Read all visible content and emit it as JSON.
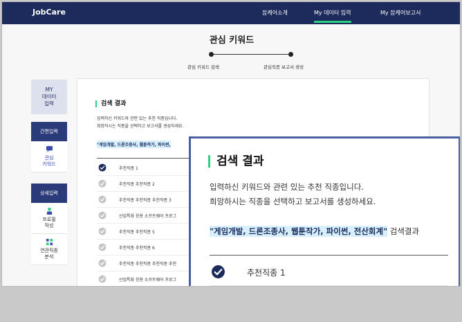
{
  "header": {
    "logo": "JobCare",
    "nav": [
      {
        "label": "잡케어소개",
        "active": false
      },
      {
        "label": "My 데이터 입력",
        "active": true
      },
      {
        "label": "My 잡케어보고서",
        "active": false
      }
    ]
  },
  "page": {
    "title": "관심 키워드",
    "steps": [
      {
        "label": "관심 키워드 검색"
      },
      {
        "label": "관심직종 보고서 생성"
      }
    ]
  },
  "sidebar": {
    "header": "MY\n데이터\n입력",
    "sections": [
      {
        "title": "간편입력",
        "items": [
          {
            "label": "관심\n키워드",
            "icon": "chat-icon",
            "active": true
          }
        ]
      },
      {
        "title": "상세입력",
        "items": [
          {
            "label": "프로필\n작성",
            "icon": "person-icon",
            "active": false
          },
          {
            "label": "연관직종\n분석",
            "icon": "grid-icon",
            "active": false
          }
        ]
      }
    ]
  },
  "results": {
    "title": "검색 결과",
    "desc_line1": "입력하신 키워드와 관련 있는 추천 직종입니다.",
    "desc_line2": "희망하시는 직종을 선택하고 보고서를 생성하세요.",
    "keywords_truncated": "\"게임개발, 드론조종사, 웹툰작가, 파이썬,",
    "keywords": "\"게임개발, 드론조종사, 웹툰작가, 파이썬, 전산회계\"",
    "keywords_suffix": " 검색결과",
    "items": [
      {
        "label": "추천직종 1",
        "checked": true
      },
      {
        "label": "추천직종 추천직종 2",
        "checked": false
      },
      {
        "label": "추천직종 추천직종 추천직종 3",
        "checked": false
      },
      {
        "label": "산업특화 응용 소프트웨어 프로그",
        "checked": false
      },
      {
        "label": "추천직종 추천직종 5",
        "checked": false
      },
      {
        "label": "추천직종 추천직종 6",
        "checked": false
      },
      {
        "label": "추천직종 추천직종 추천직종 추천",
        "checked": false
      },
      {
        "label": "산업특화 응용 소프트웨어 프로그",
        "checked": false
      }
    ],
    "zoom_items": [
      {
        "label": "추천직종 1",
        "checked": true
      },
      {
        "label": "추천직종 추천직종 2",
        "checked": false
      }
    ]
  },
  "colors": {
    "navy": "#1c2a5c",
    "accent_green": "#2bd17e",
    "highlight": "#d6f0ff",
    "check_on": "#1c2a5c",
    "check_off": "#c4c4c4"
  }
}
